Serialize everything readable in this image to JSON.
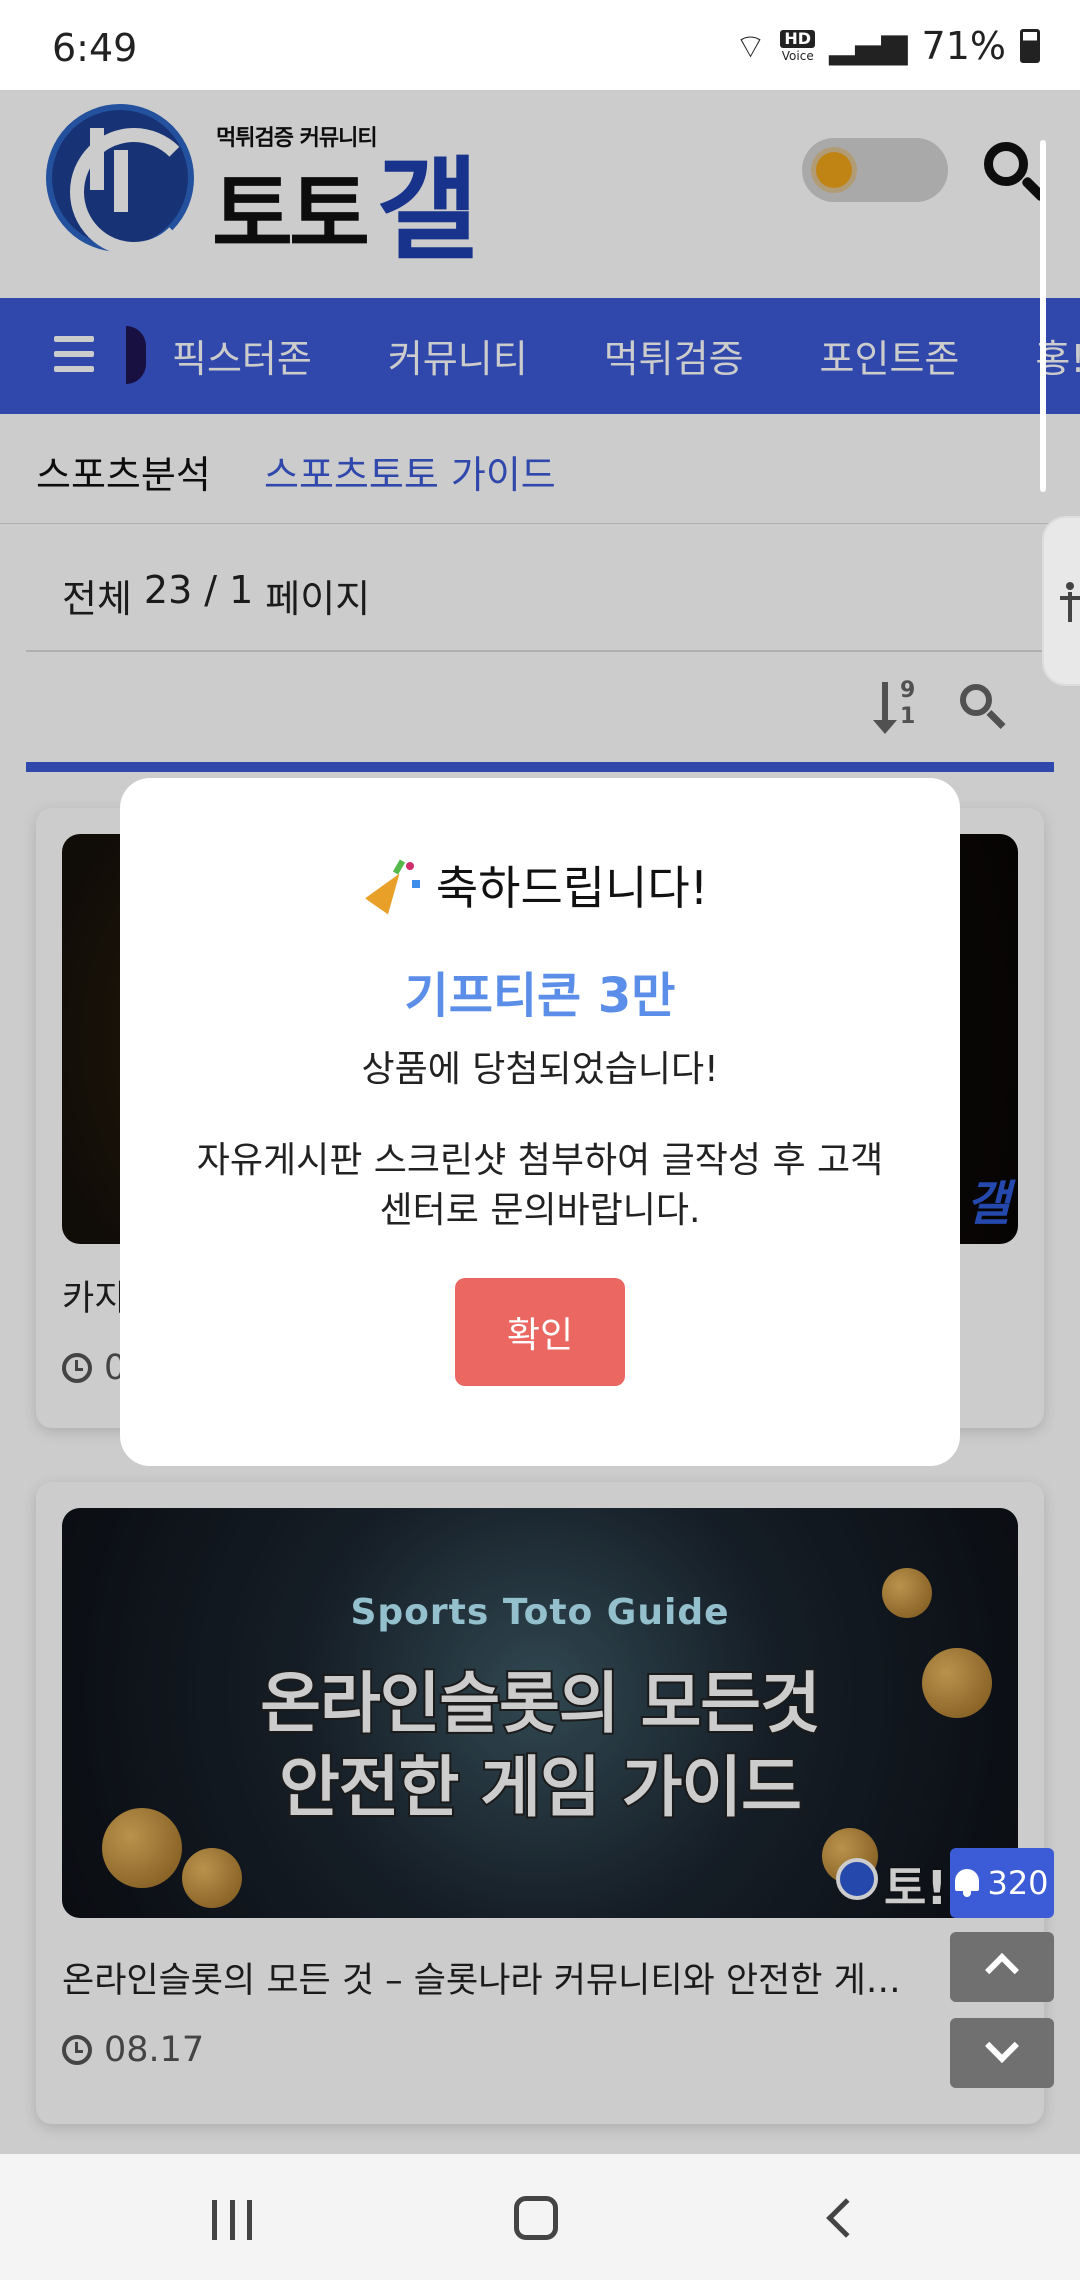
{
  "status_bar": {
    "time": "6:49",
    "hd_label": "HD",
    "voice_label": "Voice",
    "battery": "71%"
  },
  "header": {
    "logo_tagline": "먹튀검증 커뮤니티",
    "logo_text_main": "토토",
    "logo_text_accent": "갤",
    "brand_color": "#1e40af",
    "theme_icon": "sun-icon",
    "search_icon": "search-icon"
  },
  "nav": {
    "items": [
      "픽스터존",
      "커뮤니티",
      "먹튀검증",
      "포인트존",
      "홍!"
    ],
    "color": "#3c5bd6"
  },
  "sub_nav": {
    "items": [
      "스포츠분석",
      "스포츠토토 가이드"
    ],
    "active_color": "#3c5bd6"
  },
  "list_header": {
    "total_label": "전체",
    "total": "23",
    "separator": "/",
    "page": "1",
    "page_label": "페이지",
    "sort_digits_top": "9",
    "sort_digits_bottom": "1"
  },
  "posts": [
    {
      "title": "카지",
      "date": "0",
      "thumb_brand": "갤"
    },
    {
      "title": "온라인슬롯의 모든 것 – 슬롯나라 커뮤니티와 안전한 게…",
      "date": "08.17",
      "thumb_subtitle": "Sports Toto Guide",
      "thumb_line1": "온라인슬롯의 모든것",
      "thumb_line2": "안전한 게임 가이드",
      "thumb_brand": "토!"
    }
  ],
  "modal": {
    "title": "축하드립니다!",
    "prize": "기프티콘 3만",
    "won": "상품에 당첨되었습니다!",
    "instruction": "자유게시판 스크린샷 첨부하여 글작성 후 고객센터로 문의바랍니다.",
    "confirm_label": "확인",
    "prize_color": "#5b8ee8",
    "button_color": "#ea6762"
  },
  "floating": {
    "notification_count": "320"
  }
}
